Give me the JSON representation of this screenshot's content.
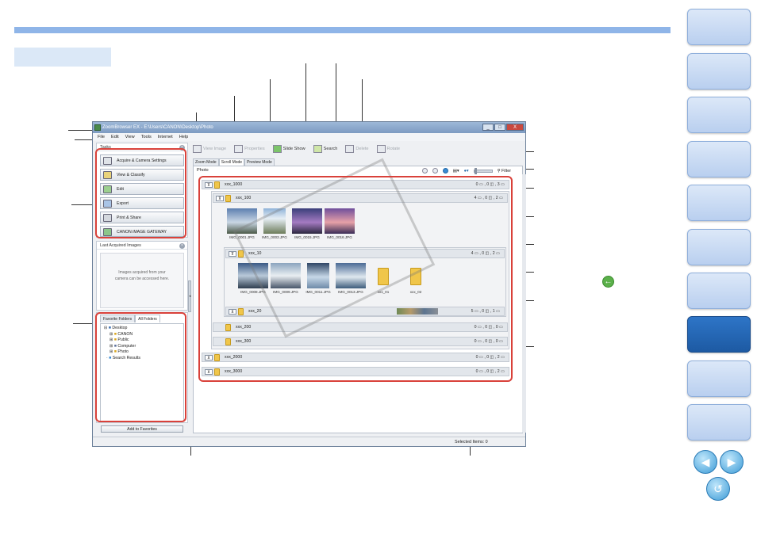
{
  "window": {
    "title": "ZoomBrowser EX  -  E:\\Users\\CANON\\Desktop\\Photo",
    "controls": [
      "_",
      "□",
      "X"
    ]
  },
  "menu": [
    "File",
    "Edit",
    "View",
    "Tools",
    "Internet",
    "Help"
  ],
  "toolbar": {
    "view_image": "View Image",
    "properties": "Properties",
    "slide_show": "Slide Show",
    "search": "Search",
    "delete": "Delete",
    "rotate": "Rotate"
  },
  "tasks": {
    "header": "Tasks",
    "items": [
      "Acquire & Camera Settings",
      "View & Classify",
      "Edit",
      "Export",
      "Print & Share",
      "CANON iMAGE GATEWAY"
    ]
  },
  "last_acquired": {
    "header": "Last Acquired Images",
    "message_line1": "Images acquired from your",
    "message_line2": "camera can be accessed here."
  },
  "folders": {
    "tabs": [
      "Favorite Folders",
      "All Folders"
    ],
    "tree": [
      "Desktop",
      "CANON",
      "Public",
      "Computer",
      "Photo",
      "Search Results"
    ],
    "add_button": "Add to Favorites"
  },
  "view_tabs": [
    "Zoom Mode",
    "Scroll Mode",
    "Preview Mode"
  ],
  "content": {
    "label": "Photo",
    "filter": "Filter",
    "rows": [
      {
        "name": "xxx_1000",
        "count": "0 ▭ , 0 ◫ , 3 ▭"
      },
      {
        "name": "xxx_100",
        "count": "4 ▭ , 0 ◫ , 2 ▭"
      },
      {
        "name": "xxx_10",
        "count": "4 ▭ , 0 ◫ , 2 ▭"
      },
      {
        "name": "xxx_20",
        "count": "5 ▭ , 0 ◫ , 1 ▭"
      },
      {
        "name": "xxx_200",
        "count": "0 ▭ , 0 ◫ , 0 ▭"
      },
      {
        "name": "xxx_300",
        "count": "0 ▭ , 0 ◫ , 0 ▭"
      },
      {
        "name": "xxx_2000",
        "count": "0 ▭ , 0 ◫ , 2 ▭"
      },
      {
        "name": "xxx_3000",
        "count": "0 ▭ , 0 ◫ , 2 ▭"
      }
    ],
    "thumbs_100": [
      "IMG_0001.JPG",
      "IMG_0003.JPG",
      "IMG_0015.JPG",
      "IMG_0016.JPG"
    ],
    "thumbs_10": [
      "IMG_0008.JPG",
      "IMG_0009.JPG",
      "IMG_0011.JPG",
      "IMG_0013.JPG",
      "xxx_01",
      "xxx_02"
    ]
  },
  "status": {
    "selected": "Selected Items: 0"
  },
  "colors": {
    "accent_bar": "#8fb5e8",
    "highlight_box": "#d9413a",
    "nav_active": "#1d5aa3"
  }
}
